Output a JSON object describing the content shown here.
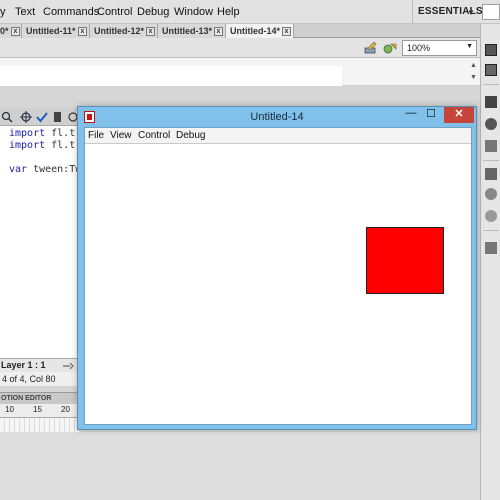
{
  "menubar": {
    "items": [
      "y",
      "Text",
      "Commands",
      "Control",
      "Debug",
      "Window",
      "Help"
    ],
    "workspace": "ESSENTIALS"
  },
  "doc_tabs": [
    {
      "label": "0*",
      "active": false
    },
    {
      "label": "Untitled-11*",
      "active": false
    },
    {
      "label": "Untitled-12*",
      "active": false
    },
    {
      "label": "Untitled-13*",
      "active": false
    },
    {
      "label": "Untitled-14*",
      "active": true
    }
  ],
  "tab_close_glyph": "x",
  "zoom": {
    "value": "100%"
  },
  "code": {
    "lines": [
      {
        "kw": "import",
        "rest": " fl.tr"
      },
      {
        "kw": "import",
        "rest": " fl.tr"
      },
      {
        "kw": "",
        "rest": ""
      },
      {
        "kw": "var",
        "rest": " tween:Tw"
      }
    ]
  },
  "status": {
    "layer": "Layer 1 : 1",
    "line": "4 of 4, Col 80"
  },
  "timeline": {
    "motion_tab": "OTION EDITOR",
    "ruler": [
      "10",
      "15",
      "20"
    ]
  },
  "player": {
    "title": "Untitled-14",
    "menu": [
      "File",
      "View",
      "Control",
      "Debug"
    ],
    "minimize_glyph": "—",
    "maximize_glyph": "☐",
    "close_glyph": "✕"
  },
  "colors": {
    "box_fill": "#ff0000",
    "titlebar": "#7fc1ea",
    "close_button": "#c7443a"
  }
}
